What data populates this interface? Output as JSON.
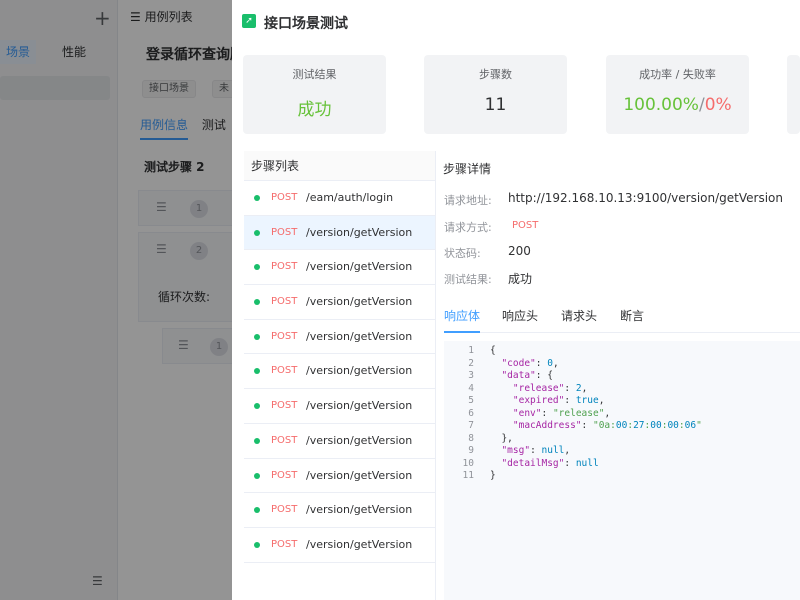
{
  "background": {
    "tabs": [
      {
        "label": "场景"
      },
      {
        "label": "性能"
      }
    ],
    "list_title": "用例列表",
    "case_title": "登录循环查询版",
    "tags": [
      {
        "label": "接口场景"
      },
      {
        "label": "未"
      }
    ],
    "detail_tabs": [
      {
        "label": "用例信息"
      },
      {
        "label": "测试"
      }
    ],
    "step_title": "测试步骤 2",
    "rows": [
      {
        "num": "1"
      },
      {
        "num": "2"
      },
      {
        "num": "1"
      }
    ],
    "loop_label": "循环次数:"
  },
  "drawer": {
    "title": "接口场景测试",
    "summary": {
      "result_label": "测试结果",
      "result_value": "成功",
      "steps_label": "步骤数",
      "steps_value": "11",
      "rate_label": "成功率 / 失败率",
      "success_rate": "100.00%",
      "rate_separator": "/",
      "fail_rate": "0%"
    },
    "step_list": {
      "header": "步骤列表",
      "items": [
        {
          "method": "POST",
          "path": "/eam/auth/login"
        },
        {
          "method": "POST",
          "path": "/version/getVersion"
        },
        {
          "method": "POST",
          "path": "/version/getVersion"
        },
        {
          "method": "POST",
          "path": "/version/getVersion"
        },
        {
          "method": "POST",
          "path": "/version/getVersion"
        },
        {
          "method": "POST",
          "path": "/version/getVersion"
        },
        {
          "method": "POST",
          "path": "/version/getVersion"
        },
        {
          "method": "POST",
          "path": "/version/getVersion"
        },
        {
          "method": "POST",
          "path": "/version/getVersion"
        },
        {
          "method": "POST",
          "path": "/version/getVersion"
        },
        {
          "method": "POST",
          "path": "/version/getVersion"
        }
      ]
    },
    "step_detail": {
      "header": "步骤详情",
      "url_label": "请求地址:",
      "url_value": "http://192.168.10.13:9100/version/getVersion",
      "method_label": "请求方式:",
      "method_value": "POST",
      "status_label": "状态码:",
      "status_value": "200",
      "result_label": "测试结果:",
      "result_value": "成功",
      "tabs": [
        {
          "label": "响应体"
        },
        {
          "label": "响应头"
        },
        {
          "label": "请求头"
        },
        {
          "label": "断言"
        }
      ],
      "response_lines": [
        {
          "n": "1",
          "t": "{"
        },
        {
          "n": "2",
          "t": "  \"code\": 0,"
        },
        {
          "n": "3",
          "t": "  \"data\": {"
        },
        {
          "n": "4",
          "t": "    \"release\": 2,"
        },
        {
          "n": "5",
          "t": "    \"expired\": true,"
        },
        {
          "n": "6",
          "t": "    \"env\": \"release\","
        },
        {
          "n": "7",
          "t": "    \"macAddress\": \"0a:00:27:00:00:06\""
        },
        {
          "n": "8",
          "t": "  },"
        },
        {
          "n": "9",
          "t": "  \"msg\": null,"
        },
        {
          "n": "10",
          "t": "  \"detailMsg\": null"
        },
        {
          "n": "11",
          "t": "}"
        }
      ]
    }
  }
}
